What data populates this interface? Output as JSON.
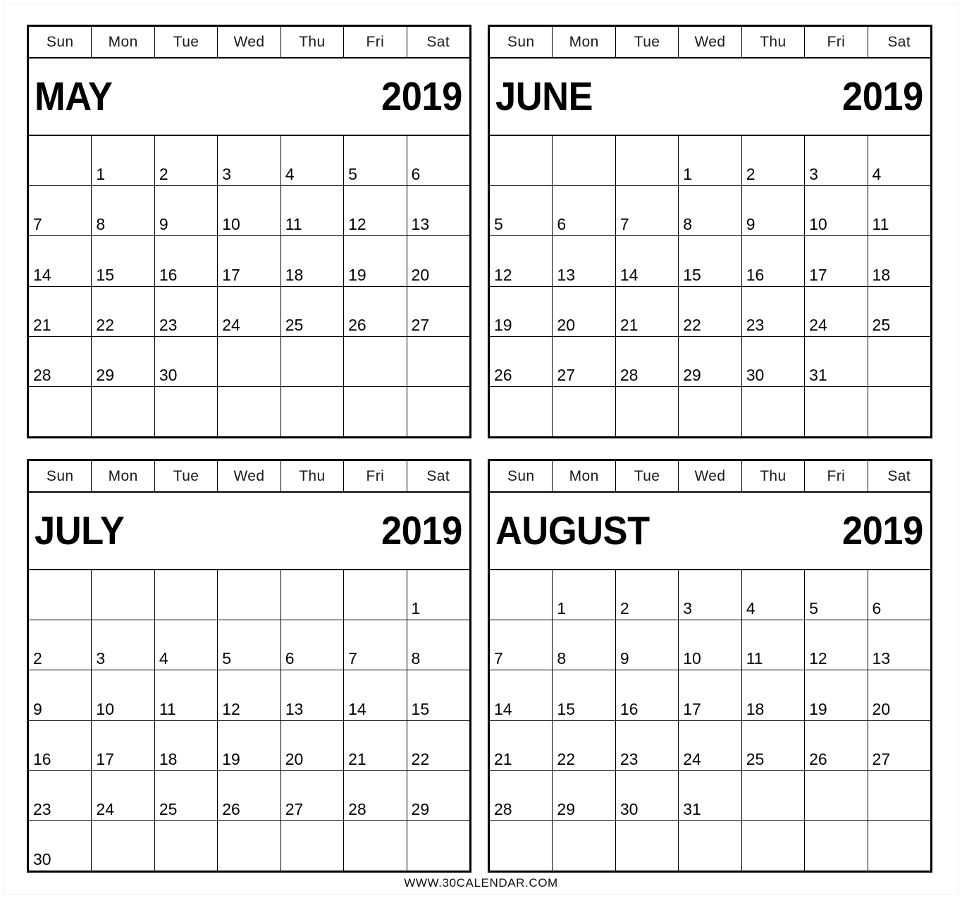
{
  "weekday_headers": [
    "Sun",
    "Mon",
    "Tue",
    "Wed",
    "Thu",
    "Fri",
    "Sat"
  ],
  "footer": {
    "text": "WWW.30CALENDAR.COM"
  },
  "colors": {
    "ink": "#000000",
    "page": "#ffffff",
    "rule": "#000000"
  },
  "calendars": [
    {
      "id": "may-2019",
      "month": "MAY",
      "year": "2019",
      "first_weekday_index": 1,
      "weeks": [
        [
          "",
          "1",
          "2",
          "3",
          "4",
          "5",
          "6"
        ],
        [
          "7",
          "8",
          "9",
          "10",
          "11",
          "12",
          "13"
        ],
        [
          "14",
          "15",
          "16",
          "17",
          "18",
          "19",
          "20"
        ],
        [
          "21",
          "22",
          "23",
          "24",
          "25",
          "26",
          "27"
        ],
        [
          "28",
          "29",
          "30",
          "",
          "",
          "",
          ""
        ],
        [
          "",
          "",
          "",
          "",
          "",
          "",
          ""
        ]
      ]
    },
    {
      "id": "june-2019",
      "month": "JUNE",
      "year": "2019",
      "first_weekday_index": 3,
      "weeks": [
        [
          "",
          "",
          "",
          "1",
          "2",
          "3",
          "4"
        ],
        [
          "5",
          "6",
          "7",
          "8",
          "9",
          "10",
          "11"
        ],
        [
          "12",
          "13",
          "14",
          "15",
          "16",
          "17",
          "18"
        ],
        [
          "19",
          "20",
          "21",
          "22",
          "23",
          "24",
          "25"
        ],
        [
          "26",
          "27",
          "28",
          "29",
          "30",
          "31",
          ""
        ],
        [
          "",
          "",
          "",
          "",
          "",
          "",
          ""
        ]
      ]
    },
    {
      "id": "july-2019",
      "month": "JULY",
      "year": "2019",
      "first_weekday_index": 6,
      "weeks": [
        [
          "",
          "",
          "",
          "",
          "",
          "",
          "1"
        ],
        [
          "2",
          "3",
          "4",
          "5",
          "6",
          "7",
          "8"
        ],
        [
          "9",
          "10",
          "11",
          "12",
          "13",
          "14",
          "15"
        ],
        [
          "16",
          "17",
          "18",
          "19",
          "20",
          "21",
          "22"
        ],
        [
          "23",
          "24",
          "25",
          "26",
          "27",
          "28",
          "29"
        ],
        [
          "30",
          "",
          "",
          "",
          "",
          "",
          ""
        ]
      ]
    },
    {
      "id": "august-2019",
      "month": "AUGUST",
      "year": "2019",
      "first_weekday_index": 1,
      "weeks": [
        [
          "",
          "1",
          "2",
          "3",
          "4",
          "5",
          "6"
        ],
        [
          "7",
          "8",
          "9",
          "10",
          "11",
          "12",
          "13"
        ],
        [
          "14",
          "15",
          "16",
          "17",
          "18",
          "19",
          "20"
        ],
        [
          "21",
          "22",
          "23",
          "24",
          "25",
          "26",
          "27"
        ],
        [
          "28",
          "29",
          "30",
          "31",
          "",
          "",
          ""
        ],
        [
          "",
          "",
          "",
          "",
          "",
          "",
          ""
        ]
      ]
    }
  ]
}
